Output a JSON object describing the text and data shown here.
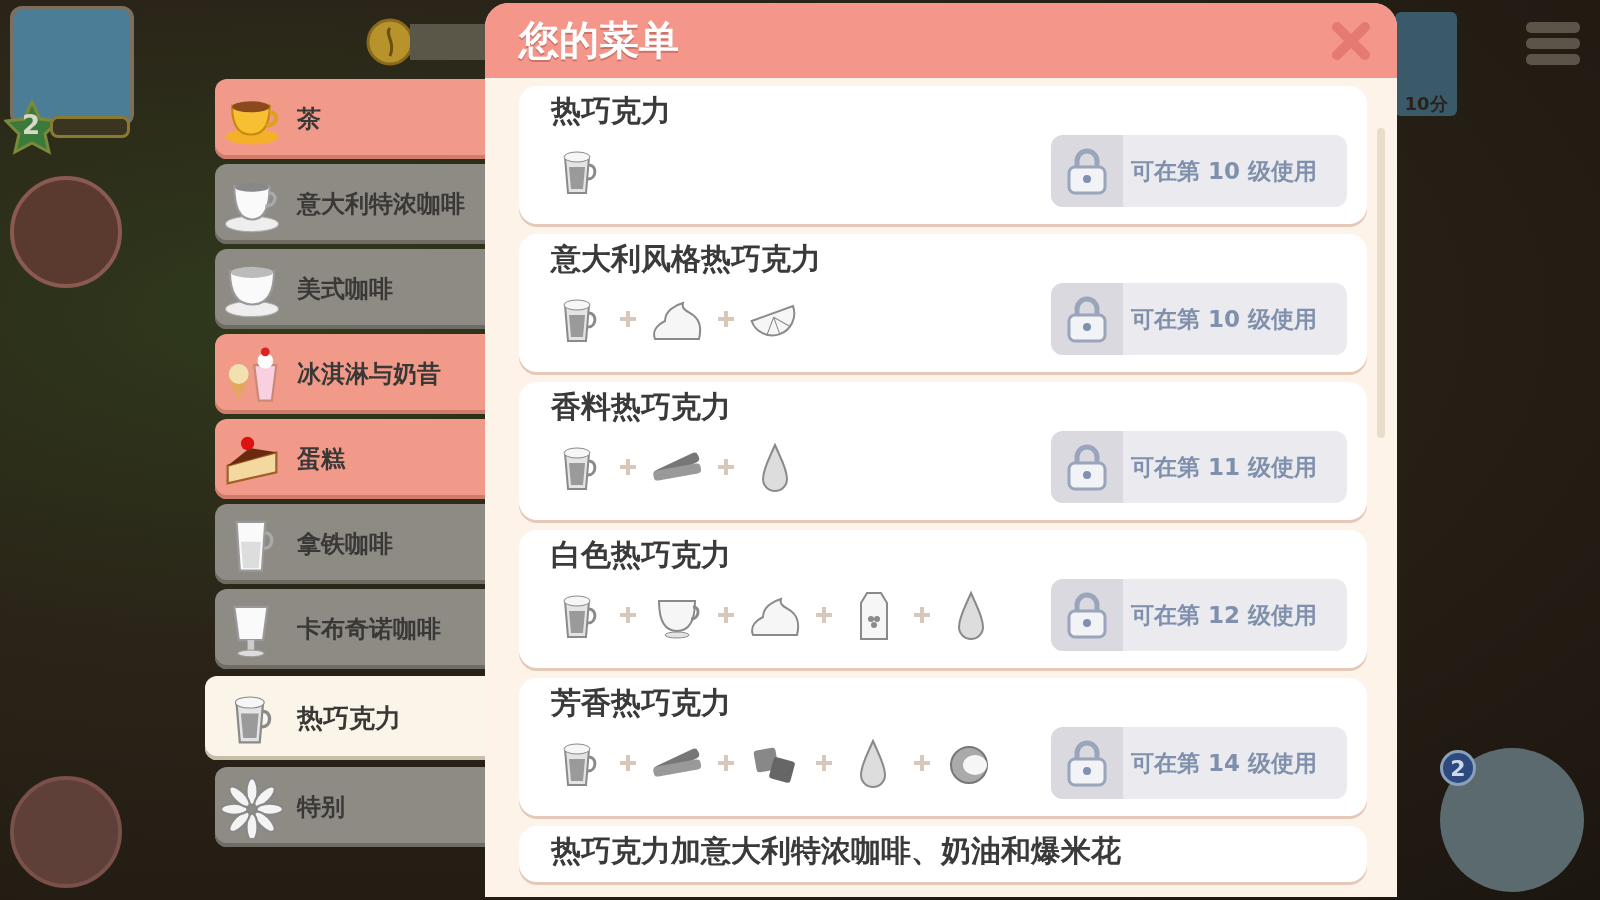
{
  "hud": {
    "level": "2",
    "gift_points": "10分",
    "register_badge": "2"
  },
  "categories": [
    {
      "label": "茶",
      "kind": "tea",
      "highlighted": true,
      "selected": false
    },
    {
      "label": "意大利特浓咖啡",
      "kind": "espresso",
      "highlighted": false,
      "selected": false
    },
    {
      "label": "美式咖啡",
      "kind": "americano",
      "highlighted": false,
      "selected": false
    },
    {
      "label": "冰淇淋与奶昔",
      "kind": "icecream",
      "highlighted": true,
      "selected": false
    },
    {
      "label": "蛋糕",
      "kind": "cake",
      "highlighted": true,
      "selected": false
    },
    {
      "label": "拿铁咖啡",
      "kind": "latte",
      "highlighted": false,
      "selected": false
    },
    {
      "label": "卡布奇诺咖啡",
      "kind": "cappuccino",
      "highlighted": false,
      "selected": false
    },
    {
      "label": "热巧克力",
      "kind": "cocoa",
      "selected": true
    },
    {
      "label": "特别",
      "kind": "special",
      "highlighted": false,
      "selected": false
    }
  ],
  "menu": {
    "title": "您的菜单",
    "recipes": [
      {
        "name": "热巧克力",
        "ingredients": [
          {
            "kind": "cocoa"
          }
        ],
        "unlock": "可在第 10 级使用"
      },
      {
        "name": "意大利风格热巧克力",
        "ingredients": [
          {
            "kind": "cocoa"
          },
          {
            "kind": "cream"
          },
          {
            "kind": "lemon"
          }
        ],
        "unlock": "可在第 10 级使用"
      },
      {
        "name": "香料热巧克力",
        "ingredients": [
          {
            "kind": "cocoa"
          },
          {
            "kind": "cinnamon"
          },
          {
            "kind": "drop"
          }
        ],
        "unlock": "可在第 11 级使用"
      },
      {
        "name": "白色热巧克力",
        "ingredients": [
          {
            "kind": "cocoa"
          },
          {
            "kind": "milk"
          },
          {
            "kind": "cream"
          },
          {
            "kind": "carton"
          },
          {
            "kind": "drop"
          }
        ],
        "unlock": "可在第 12 级使用"
      },
      {
        "name": "芳香热巧克力",
        "ingredients": [
          {
            "kind": "cocoa"
          },
          {
            "kind": "cinnamon"
          },
          {
            "kind": "chocolate"
          },
          {
            "kind": "drop"
          },
          {
            "kind": "coconut"
          }
        ],
        "unlock": "可在第 14 级使用"
      },
      {
        "name": "热巧克力加意大利特浓咖啡、奶油和爆米花"
      }
    ]
  }
}
